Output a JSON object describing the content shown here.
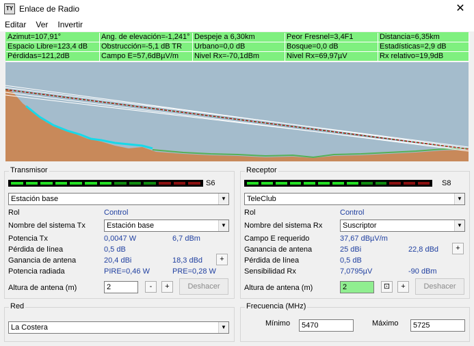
{
  "window": {
    "title": "Enlace de Radio",
    "icon_text": "TY"
  },
  "menu": [
    "Editar",
    "Ver",
    "Invertir"
  ],
  "info": [
    "Azimut=107,91°",
    "Ang. de elevación=-1,241°",
    "Despeje a 6,30km",
    "Peor Fresnel=3,4F1",
    "Distancia=6,35km",
    "Espacio Libre=123,4 dB",
    "Obstrucción=-5,1 dB TR",
    "Urbano=0,0 dB",
    "Bosque=0,0 dB",
    "Estadísticas=2,9 dB",
    "Pérdidas=121,2dB",
    "Campo E=57,6dBµV/m",
    "Nivel Rx=-70,1dBm",
    "Nivel Rx=69,97µV",
    "Rx relativo=19,9dB"
  ],
  "transmitter": {
    "title": "Transmisor",
    "signal_label": "S6",
    "signal_colors": [
      "#22dd22",
      "#22dd22",
      "#22dd22",
      "#22dd22",
      "#22dd22",
      "#22dd22",
      "#22dd22",
      "#0e8a0e",
      "#0e8a0e",
      "#0e8a0e",
      "#8a1010",
      "#8a1010",
      "#8a1010"
    ],
    "station": "Estación base",
    "rol_label": "Rol",
    "rol_value": "Control",
    "system_label": "Nombre del sistema Tx",
    "system_value": "Estación base",
    "rows": [
      {
        "label": "Potencia Tx",
        "v1": "0,0047 W",
        "v2": "6,7 dBm"
      },
      {
        "label": "Pérdida de línea",
        "v1": "0,5 dB",
        "v2": ""
      },
      {
        "label": "Ganancia de antena",
        "v1": "20,4 dBi",
        "v2": "18,3 dBd"
      },
      {
        "label": "Potencia radiada",
        "v1": "PIRE=0,46 W",
        "v2": "PRE=0,28 W"
      }
    ],
    "height_label": "Altura de antena (m)",
    "height_value": "2",
    "undo": "Deshacer"
  },
  "receiver": {
    "title": "Receptor",
    "signal_label": "S8",
    "signal_colors": [
      "#22dd22",
      "#22dd22",
      "#22dd22",
      "#22dd22",
      "#22dd22",
      "#22dd22",
      "#22dd22",
      "#22dd22",
      "#0e8a0e",
      "#0e8a0e",
      "#8a1010",
      "#8a1010",
      "#8a1010"
    ],
    "station": "TeleClub",
    "rol_label": "Rol",
    "rol_value": "Control",
    "system_label": "Nombre del sistema Rx",
    "system_value": "Suscriptor",
    "rows": [
      {
        "label": "Campo E requerido",
        "v1": "37,67 dBµV/m",
        "v2": ""
      },
      {
        "label": "Ganancia de antena",
        "v1": "25 dBi",
        "v2": "22,8 dBd"
      },
      {
        "label": "Pérdida de línea",
        "v1": "0,5 dB",
        "v2": ""
      },
      {
        "label": "Sensibilidad Rx",
        "v1": "7,0795µV",
        "v2": "-90 dBm"
      }
    ],
    "height_label": "Altura de antena (m)",
    "height_value": "2",
    "undo": "Deshacer"
  },
  "net": {
    "title": "Red",
    "value": "La Costera"
  },
  "freq": {
    "title": "Frecuencia (MHz)",
    "min_label": "Mínimo",
    "min_value": "5470",
    "max_label": "Máximo",
    "max_value": "5725"
  },
  "buttons": {
    "plus": "+",
    "minus": "-",
    "box": "⊡"
  },
  "colors": {
    "info_bg": "#7ff07f",
    "sky": "#a4bccc",
    "terrain": "#c8895a",
    "link_line": "#cc0000"
  }
}
